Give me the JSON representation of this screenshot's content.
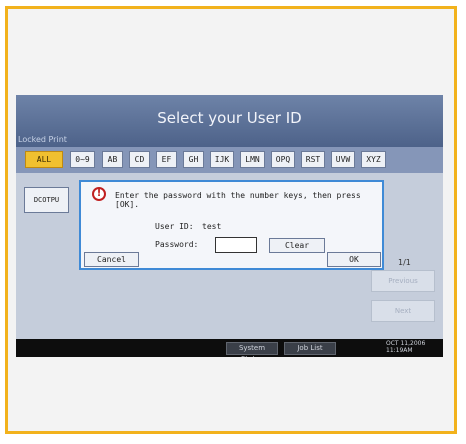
{
  "window": {
    "title": "Select your User ID",
    "section_label": "Locked Print"
  },
  "tabs": [
    "ALL",
    "0~9",
    "AB",
    "CD",
    "EF",
    "GH",
    "IJK",
    "LMN",
    "OPQ",
    "RST",
    "UVW",
    "XYZ"
  ],
  "active_tab": "ALL",
  "users": [
    "DCOTPU"
  ],
  "pagination": {
    "indicator": "1/1",
    "previous_label": "Previous",
    "next_label": "Next"
  },
  "statusbar": {
    "system_status_label": "System Status",
    "job_list_label": "Job List",
    "date": "OCT 11,2006",
    "time": "11:19AM"
  },
  "dialog": {
    "message": "Enter the password with the number keys, then press [OK].",
    "user_id_label": "User ID:",
    "user_id_value": "test",
    "password_label": "Password:",
    "password_value": "",
    "clear_label": "Clear",
    "cancel_label": "Cancel",
    "ok_label": "OK"
  },
  "colors": {
    "frame": "#f2b21c",
    "active_tab": "#f0c030",
    "dialog_border": "#3f8ad6",
    "warning": "#c02020"
  },
  "icons": [
    "warning-icon"
  ]
}
